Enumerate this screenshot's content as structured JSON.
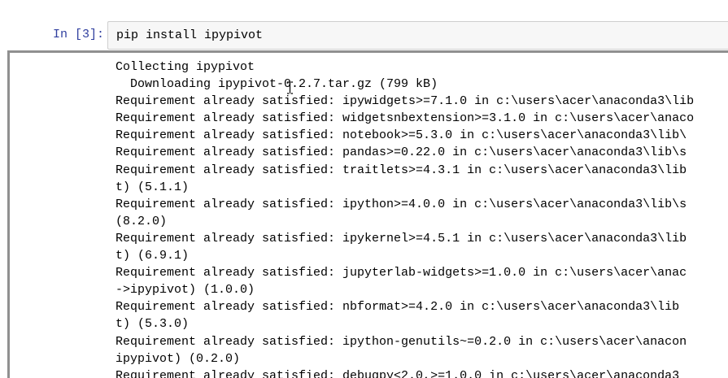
{
  "cell": {
    "prompt": "In [3]:",
    "input_code": "pip install ipypivot"
  },
  "output": {
    "lines": [
      "Collecting ipypivot",
      "  Downloading ipypivot-0.2.7.tar.gz (799 kB)",
      "Requirement already satisfied: ipywidgets>=7.1.0 in c:\\users\\acer\\anaconda3\\lib",
      "Requirement already satisfied: widgetsnbextension>=3.1.0 in c:\\users\\acer\\anaco",
      "Requirement already satisfied: notebook>=5.3.0 in c:\\users\\acer\\anaconda3\\lib\\",
      "Requirement already satisfied: pandas>=0.22.0 in c:\\users\\acer\\anaconda3\\lib\\s",
      "Requirement already satisfied: traitlets>=4.3.1 in c:\\users\\acer\\anaconda3\\lib",
      "t) (5.1.1)",
      "Requirement already satisfied: ipython>=4.0.0 in c:\\users\\acer\\anaconda3\\lib\\s",
      "(8.2.0)",
      "Requirement already satisfied: ipykernel>=4.5.1 in c:\\users\\acer\\anaconda3\\lib",
      "t) (6.9.1)",
      "Requirement already satisfied: jupyterlab-widgets>=1.0.0 in c:\\users\\acer\\anac",
      "->ipypivot) (1.0.0)",
      "Requirement already satisfied: nbformat>=4.2.0 in c:\\users\\acer\\anaconda3\\lib",
      "t) (5.3.0)",
      "Requirement already satisfied: ipython-genutils~=0.2.0 in c:\\users\\acer\\anacon",
      "ipypivot) (0.2.0)",
      "Requirement already satisfied: debugpy<2.0,>=1.0.0 in c:\\users\\acer\\anaconda3"
    ]
  },
  "colors": {
    "prompt": "#303f9f",
    "input_background": "#f7f7f7",
    "output_border": "#909090"
  },
  "icons": {
    "cursor": "text-cursor-icon"
  }
}
